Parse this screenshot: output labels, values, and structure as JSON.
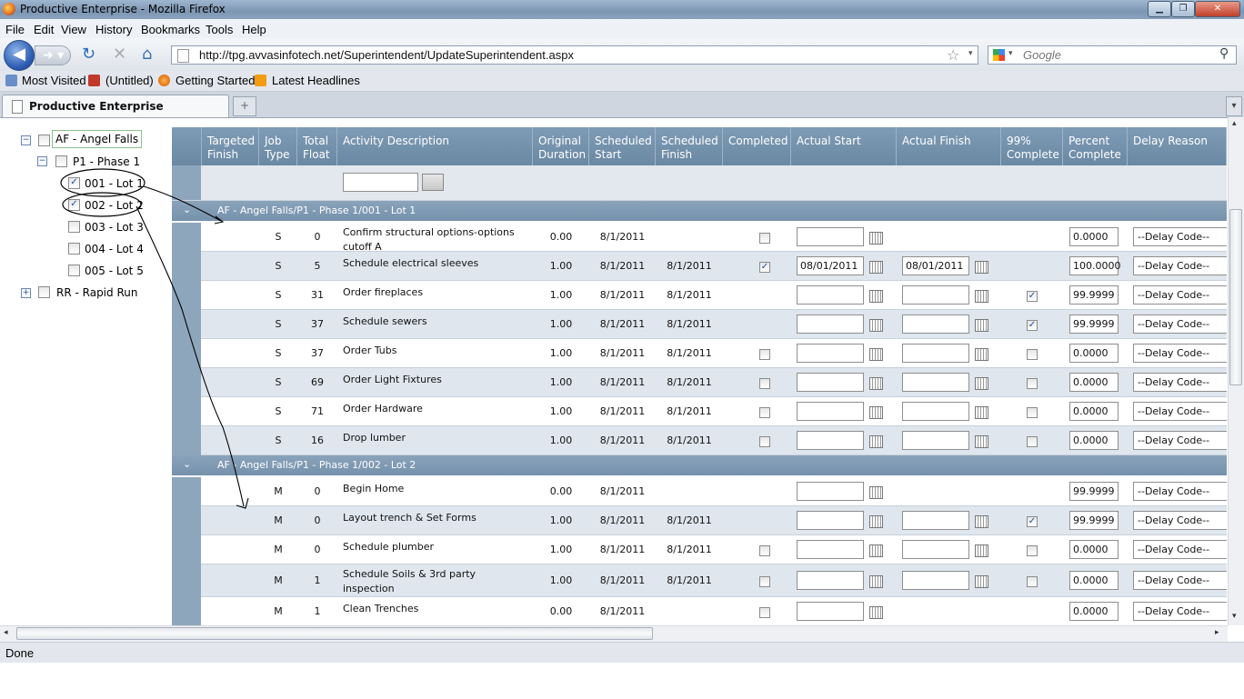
{
  "window": {
    "title": "Productive Enterprise - Mozilla Firefox"
  },
  "menu": [
    "File",
    "Edit",
    "View",
    "History",
    "Bookmarks",
    "Tools",
    "Help"
  ],
  "address": {
    "url": "http://tpg.avvasinfotech.net/Superintendent/UpdateSuperintendent.aspx"
  },
  "search": {
    "placeholder": "Google"
  },
  "bookmarks": [
    "Most Visited",
    "(Untitled)",
    "Getting Started",
    "Latest Headlines"
  ],
  "tab": {
    "label": "Productive Enterprise"
  },
  "tree": {
    "items": [
      {
        "label": "AF - Angel Falls",
        "toggle": "−",
        "checked": false
      },
      {
        "label": "P1 - Phase 1",
        "toggle": "−",
        "checked": false
      },
      {
        "label": "001 - Lot 1",
        "checked": true
      },
      {
        "label": "002 - Lot 2",
        "checked": true
      },
      {
        "label": "003 - Lot 3",
        "checked": false
      },
      {
        "label": "004 - Lot 4",
        "checked": false
      },
      {
        "label": "005 - Lot 5",
        "checked": false
      },
      {
        "label": "RR - Rapid Run",
        "toggle": "+",
        "checked": false
      }
    ]
  },
  "grid": {
    "columns": [
      "Targeted\nFinish",
      "Job\nType",
      "Total\nFloat",
      "Activity Description",
      "Original\nDuration",
      "Scheduled\nStart",
      "Scheduled\nFinish",
      "Completed",
      "Actual Start",
      "Actual Finish",
      "99%\nComplete",
      "Percent\nComplete",
      "Delay Reason"
    ],
    "groups": [
      {
        "label": "AF - Angel Falls/P1 - Phase 1/001 - Lot 1",
        "rows": [
          {
            "type": "S",
            "float": "0",
            "desc": "Confirm structural options-options cutoff A",
            "dur": "0.00",
            "start": "8/1/2011",
            "finish": "",
            "completed": false,
            "showCompleted": true,
            "astart": "",
            "showAFinish": false,
            "afinish": "",
            "c99": false,
            "show99": false,
            "pct": "0.0000",
            "delay": "--Delay Code--"
          },
          {
            "type": "S",
            "float": "5",
            "desc": "Schedule electrical sleeves",
            "dur": "1.00",
            "start": "8/1/2011",
            "finish": "8/1/2011",
            "completed": true,
            "showCompleted": true,
            "astart": "08/01/2011",
            "showAFinish": true,
            "afinish": "08/01/2011",
            "c99": false,
            "show99": false,
            "pct": "100.0000",
            "delay": "--Delay Code--"
          },
          {
            "type": "S",
            "float": "31",
            "desc": "Order fireplaces",
            "dur": "1.00",
            "start": "8/1/2011",
            "finish": "8/1/2011",
            "completed": false,
            "showCompleted": false,
            "astart": "",
            "showAFinish": true,
            "afinish": "",
            "c99": true,
            "show99": true,
            "pct": "99.9999",
            "delay": "--Delay Code--"
          },
          {
            "type": "S",
            "float": "37",
            "desc": "Schedule sewers",
            "dur": "1.00",
            "start": "8/1/2011",
            "finish": "8/1/2011",
            "completed": false,
            "showCompleted": false,
            "astart": "",
            "showAFinish": true,
            "afinish": "",
            "c99": true,
            "show99": true,
            "pct": "99.9999",
            "delay": "--Delay Code--"
          },
          {
            "type": "S",
            "float": "37",
            "desc": "Order Tubs",
            "dur": "1.00",
            "start": "8/1/2011",
            "finish": "8/1/2011",
            "completed": false,
            "showCompleted": true,
            "astart": "",
            "showAFinish": true,
            "afinish": "",
            "c99": false,
            "show99": true,
            "pct": "0.0000",
            "delay": "--Delay Code--"
          },
          {
            "type": "S",
            "float": "69",
            "desc": "Order Light Fixtures",
            "dur": "1.00",
            "start": "8/1/2011",
            "finish": "8/1/2011",
            "completed": false,
            "showCompleted": true,
            "astart": "",
            "showAFinish": true,
            "afinish": "",
            "c99": false,
            "show99": true,
            "pct": "0.0000",
            "delay": "--Delay Code--"
          },
          {
            "type": "S",
            "float": "71",
            "desc": "Order Hardware",
            "dur": "1.00",
            "start": "8/1/2011",
            "finish": "8/1/2011",
            "completed": false,
            "showCompleted": true,
            "astart": "",
            "showAFinish": true,
            "afinish": "",
            "c99": false,
            "show99": true,
            "pct": "0.0000",
            "delay": "--Delay Code--"
          },
          {
            "type": "S",
            "float": "16",
            "desc": "Drop lumber",
            "dur": "1.00",
            "start": "8/1/2011",
            "finish": "8/1/2011",
            "completed": false,
            "showCompleted": true,
            "astart": "",
            "showAFinish": true,
            "afinish": "",
            "c99": false,
            "show99": true,
            "pct": "0.0000",
            "delay": "--Delay Code--"
          }
        ]
      },
      {
        "label": "AF - Angel Falls/P1 - Phase 1/002 - Lot 2",
        "rows": [
          {
            "type": "M",
            "float": "0",
            "desc": "Begin Home",
            "dur": "0.00",
            "start": "8/1/2011",
            "finish": "",
            "completed": false,
            "showCompleted": false,
            "astart": "",
            "showAFinish": false,
            "afinish": "",
            "c99": false,
            "show99": false,
            "pct": "99.9999",
            "delay": "--Delay Code--"
          },
          {
            "type": "M",
            "float": "0",
            "desc": "Layout trench & Set Forms",
            "dur": "1.00",
            "start": "8/1/2011",
            "finish": "8/1/2011",
            "completed": false,
            "showCompleted": false,
            "astart": "",
            "showAFinish": true,
            "afinish": "",
            "c99": true,
            "show99": true,
            "pct": "99.9999",
            "delay": "--Delay Code--"
          },
          {
            "type": "M",
            "float": "0",
            "desc": "Schedule plumber",
            "dur": "1.00",
            "start": "8/1/2011",
            "finish": "8/1/2011",
            "completed": false,
            "showCompleted": true,
            "astart": "",
            "showAFinish": true,
            "afinish": "",
            "c99": false,
            "show99": true,
            "pct": "0.0000",
            "delay": "--Delay Code--"
          },
          {
            "type": "M",
            "float": "1",
            "desc": "Schedule Soils & 3rd party inspection",
            "dur": "1.00",
            "start": "8/1/2011",
            "finish": "8/1/2011",
            "completed": false,
            "showCompleted": true,
            "astart": "",
            "showAFinish": true,
            "afinish": "",
            "c99": false,
            "show99": true,
            "pct": "0.0000",
            "delay": "--Delay Code--"
          },
          {
            "type": "M",
            "float": "1",
            "desc": "Clean Trenches",
            "dur": "0.00",
            "start": "8/1/2011",
            "finish": "",
            "completed": false,
            "showCompleted": true,
            "astart": "",
            "showAFinish": false,
            "afinish": "",
            "c99": false,
            "show99": false,
            "pct": "0.0000",
            "delay": "--Delay Code--"
          }
        ]
      }
    ]
  },
  "status": {
    "text": "Done"
  },
  "colors": {
    "gridHeader": "#7591ab",
    "rowAlt": "#dfe6ee",
    "annotation": "#000000"
  }
}
